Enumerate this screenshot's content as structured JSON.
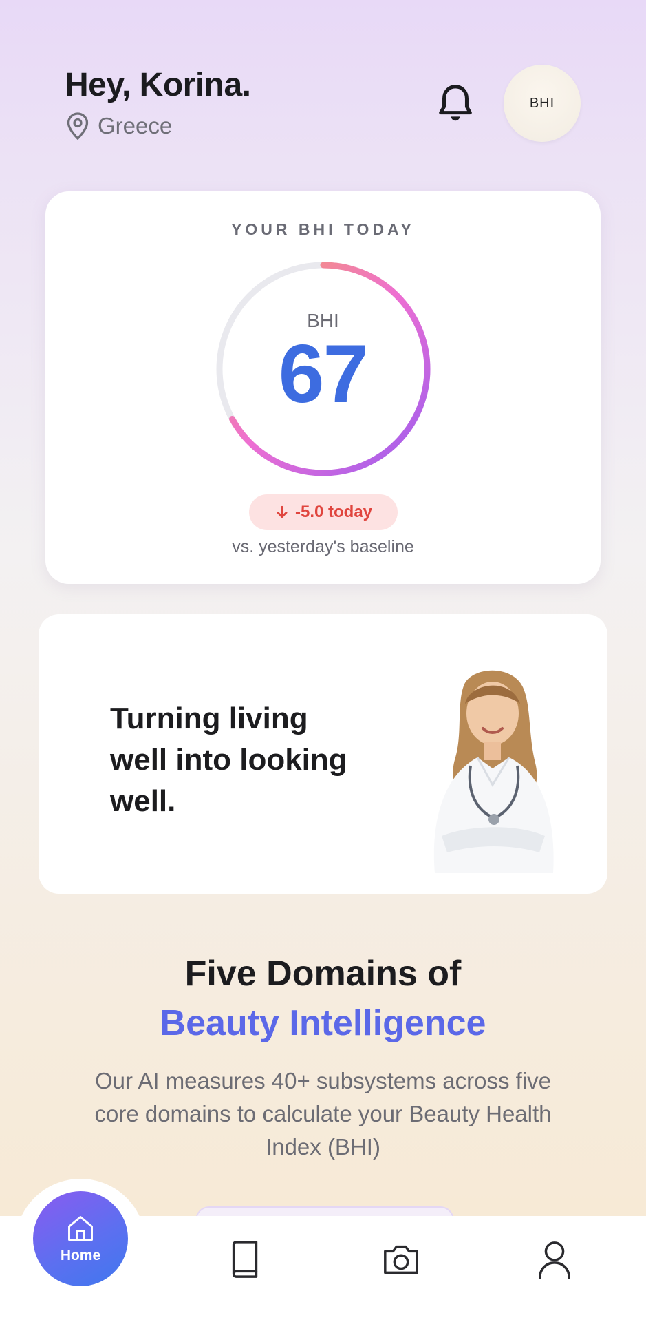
{
  "header": {
    "greeting": "Hey, Korina.",
    "location": "Greece",
    "avatar_text": "BHI"
  },
  "bhi_card": {
    "kicker": "YOUR BHI TODAY",
    "gauge_label": "BHI",
    "score": "67",
    "score_fraction": 0.67,
    "delta": "-5.0 today",
    "baseline_text": "vs. yesterday's baseline"
  },
  "promo": {
    "text": "Turning living well into looking well."
  },
  "domains": {
    "title": "Five Domains of",
    "subtitle": "Beauty Intelligence",
    "description": "Our AI measures 40+ subsystems across five core domains to calculate your Beauty Health Index (BHI)"
  },
  "nav": {
    "home_label": "Home",
    "items": [
      "home-icon",
      "book-icon",
      "camera-icon",
      "profile-icon"
    ]
  },
  "colors": {
    "accent": "#5b68e8",
    "score": "#3d6ce0",
    "negative": "#e0453e",
    "gauge_start": "#f6a05a",
    "gauge_mid": "#ee6fd2",
    "gauge_end": "#9a5cf0"
  }
}
